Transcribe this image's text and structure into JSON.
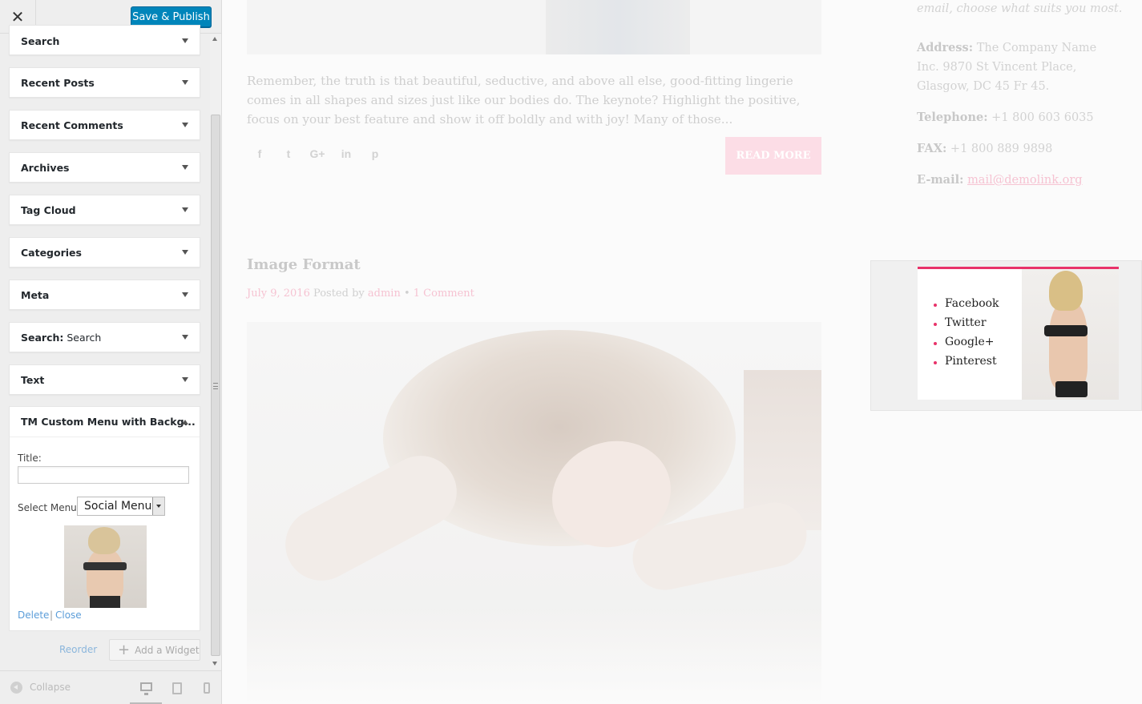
{
  "topbar": {
    "close_symbol": "✕",
    "publish_label": "Save & Publish"
  },
  "widgets": [
    {
      "title": "Search",
      "subtitle": ""
    },
    {
      "title": "Recent Posts",
      "subtitle": ""
    },
    {
      "title": "Recent Comments",
      "subtitle": ""
    },
    {
      "title": "Archives",
      "subtitle": ""
    },
    {
      "title": "Tag Cloud",
      "subtitle": ""
    },
    {
      "title": "Categories",
      "subtitle": ""
    },
    {
      "title": "Meta",
      "subtitle": ""
    },
    {
      "title": "Search:",
      "subtitle": " Search"
    },
    {
      "title": "Text",
      "subtitle": ""
    }
  ],
  "expanded_widget": {
    "title": "TM Custom Menu with Backg...",
    "title_label": "Title:",
    "title_value": "",
    "select_label": "Select Menu:",
    "select_value": "Social Menu",
    "delete_label": "Delete",
    "separator": "|",
    "close_label": "Close"
  },
  "panel_actions": {
    "reorder_label": "Reorder",
    "add_widget_label": "Add a Widget",
    "add_icon": "+"
  },
  "footer": {
    "collapse_label": "Collapse",
    "devices": [
      "desktop-icon",
      "tablet-icon",
      "mobile-icon"
    ]
  },
  "preview": {
    "excerpt": "Remember, the truth is that beautiful, seductive, and above all else, good-fitting lingerie comes in all shapes and sizes just like our bodies do. The keynote? Highlight the positive, focus on your best feature and show it off boldly and with joy! Many of those...",
    "social_icons": [
      "f",
      "t",
      "G+",
      "in",
      "p"
    ],
    "read_more": "Read more",
    "post_title": "Image Format",
    "post_date": "July 9, 2016",
    "posted_by": "Posted by",
    "author": "admin",
    "dot": "•",
    "comments": "1 Comment",
    "contact": {
      "intro": "email, choose what suits you most.",
      "address_label": "Address:",
      "address_value": "The Company Name Inc. 9870 St Vincent Place, Glasgow, DC 45 Fr 45.",
      "phone_label": "Telephone:",
      "phone_value": "+1 800 603 6035",
      "fax_label": "FAX:",
      "fax_value": "+1 800 889 9898",
      "email_label": "E-mail:",
      "email_value": "mail@demolink.org"
    },
    "social_menu": [
      "Facebook",
      "Twitter",
      "Google+",
      "Pinterest"
    ],
    "accent_color": "#e8336a"
  }
}
